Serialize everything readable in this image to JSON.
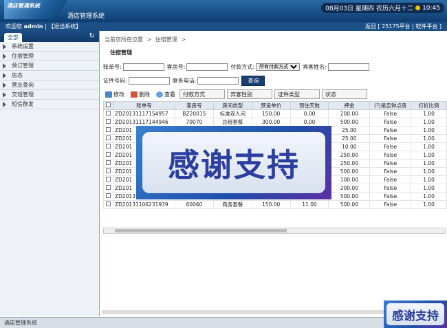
{
  "header": {
    "logo_text": "酒店管理系统",
    "system_name": "酒店管理系统",
    "date": "08月03日",
    "weekday": "星期四",
    "lunar": "农历六月十二",
    "time": "10:45"
  },
  "topbar": {
    "welcome": "欢迎您",
    "user": "admin",
    "logout": "【退出系统】",
    "right": "返回 [ 25175平台 | 软件平台 ]"
  },
  "sidebar": {
    "tab": "全部",
    "items": [
      "系统设置",
      "住宿管理",
      "预订管理",
      "房态",
      "营业查询",
      "交班管理",
      "短信群发"
    ]
  },
  "breadcrumb": {
    "prefix": "当前您所在位置",
    "sep": ">",
    "current": "住宿管理",
    "tail": ">"
  },
  "panel_title": "住宿管理",
  "search": {
    "bill_no": "账单号:",
    "room_no": "客房号:",
    "payment": "付款方式:",
    "payment_value": "所有付款方式",
    "guest_name": "宾客姓名:",
    "id_no": "证件号码:",
    "phone": "联系电话:",
    "query": "查询"
  },
  "toolbar": {
    "edit": "修改",
    "delete": "删除",
    "view": "查看",
    "f1": "付款方式",
    "f2": "宾客性别",
    "f3": "证件类型",
    "f4": "状态"
  },
  "table": {
    "headers": [
      "",
      "账单号",
      "客房号",
      "房间类型",
      "预设单价",
      "预住天数",
      "押金",
      "(?)是否钟点房",
      "打折比例"
    ],
    "rows": [
      [
        "",
        "ZD20131117154957",
        "BZ20015",
        "标准双人间",
        "150.00",
        "0.00",
        "200.00",
        "False",
        "1.00"
      ],
      [
        "",
        "ZD20131117144946",
        "70070",
        "总统套餐",
        "300.00",
        "0.00",
        "500.00",
        "False",
        "1.00"
      ],
      [
        "",
        "ZD201",
        "",
        "",
        "",
        "",
        "25.00",
        "False",
        "1.00"
      ],
      [
        "",
        "ZD201",
        "",
        "",
        "",
        "",
        "25.00",
        "False",
        "1.00"
      ],
      [
        "",
        "ZD201",
        "",
        "",
        "",
        "",
        "10.00",
        "False",
        "1.00"
      ],
      [
        "",
        "ZD201",
        "",
        "",
        "",
        "",
        "250.00",
        "False",
        "1.00"
      ],
      [
        "",
        "ZD201",
        "",
        "",
        "",
        "",
        "250.00",
        "False",
        "1.00"
      ],
      [
        "",
        "ZD201",
        "",
        "",
        "",
        "",
        "500.00",
        "False",
        "1.00"
      ],
      [
        "",
        "ZD201",
        "",
        "",
        "",
        "",
        "100.00",
        "False",
        "1.00"
      ],
      [
        "",
        "ZD201",
        "",
        "",
        "",
        "",
        "200.00",
        "False",
        "1.00"
      ],
      [
        "",
        "ZD20131106231950",
        "70070",
        "总统套餐",
        "300.00",
        "0.00",
        "500.00",
        "False",
        "1.00"
      ],
      [
        "",
        "ZD20131106231939",
        "60060",
        "商务套餐",
        "150.00",
        "11.00",
        "500.00",
        "False",
        "1.00"
      ]
    ]
  },
  "banner": {
    "text": "感谢支持"
  },
  "footer": {
    "text": "酒店管理系统"
  }
}
